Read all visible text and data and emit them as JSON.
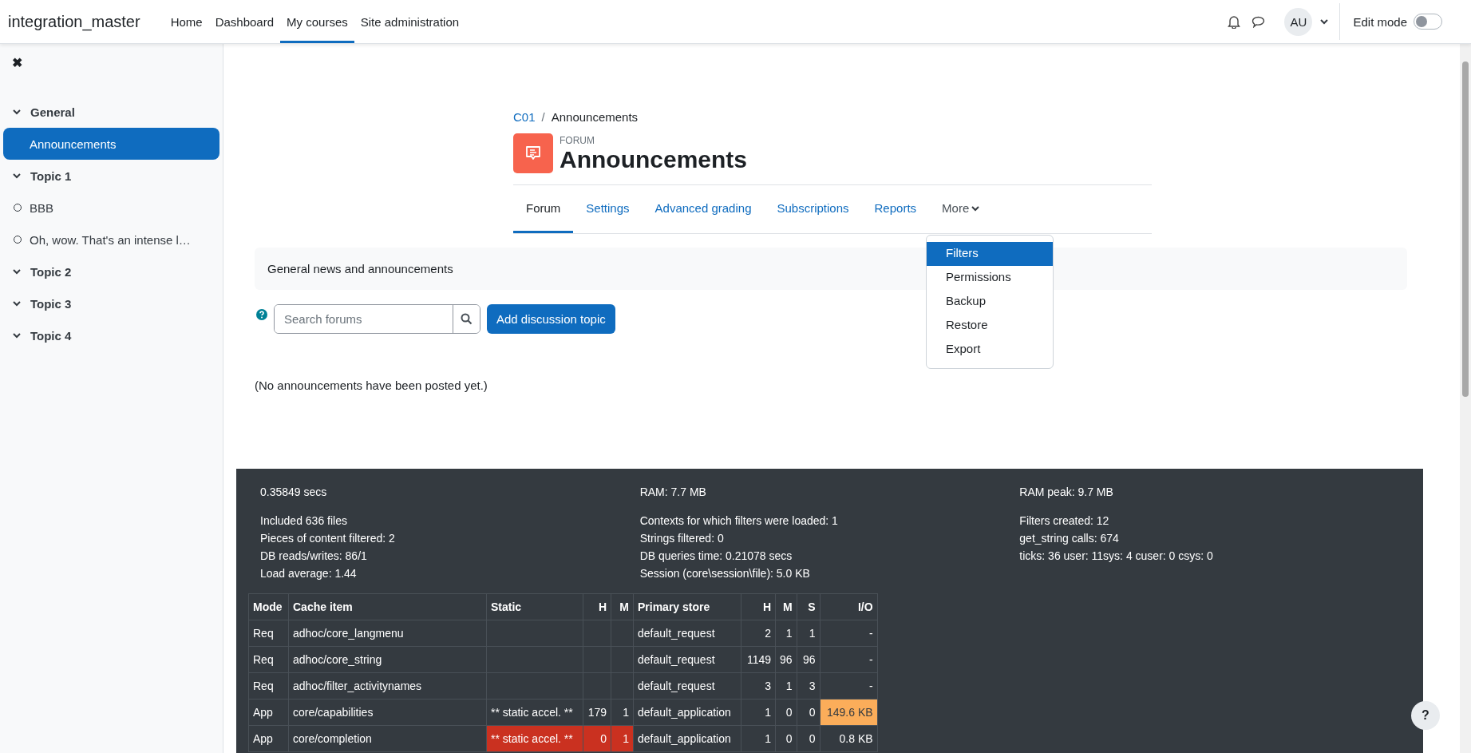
{
  "navbar": {
    "site_name": "integration_master",
    "links": [
      {
        "label": "Home",
        "selected": false
      },
      {
        "label": "Dashboard",
        "selected": false
      },
      {
        "label": "My courses",
        "selected": true
      },
      {
        "label": "Site administration",
        "selected": false
      }
    ],
    "avatar": "AU",
    "edit_mode": {
      "label": "Edit mode",
      "on": false
    }
  },
  "sidebar": {
    "close": "✖",
    "sections": [
      {
        "title": "General",
        "expanded": true,
        "items": [
          {
            "label": "Announcements",
            "kind": "forum",
            "selected": true
          }
        ]
      },
      {
        "title": "Topic 1",
        "expanded": true,
        "items": [
          {
            "label": "BBB",
            "kind": "activity",
            "selected": false
          },
          {
            "label": "Oh, wow. That's an intense l…",
            "kind": "activity",
            "selected": false
          }
        ]
      },
      {
        "title": "Topic 2",
        "expanded": true
      },
      {
        "title": "Topic 3",
        "expanded": true
      },
      {
        "title": "Topic 4",
        "expanded": true
      }
    ]
  },
  "breadcrumb": {
    "items": [
      "C01",
      "Announcements"
    ],
    "separator": "/"
  },
  "page_header": {
    "kind_label": "FORUM",
    "title": "Announcements"
  },
  "tabs": [
    {
      "label": "Forum",
      "selected": true
    },
    {
      "label": "Settings",
      "selected": false
    },
    {
      "label": "Advanced grading",
      "selected": false
    },
    {
      "label": "Subscriptions",
      "selected": false
    },
    {
      "label": "Reports",
      "selected": false
    },
    {
      "label": "More",
      "selected": false
    }
  ],
  "more_menu": [
    {
      "label": "Filters",
      "selected": true
    },
    {
      "label": "Permissions",
      "selected": false
    },
    {
      "label": "Backup",
      "selected": false
    },
    {
      "label": "Restore",
      "selected": false
    },
    {
      "label": "Export",
      "selected": false
    }
  ],
  "intro": "General news and announcements",
  "search": {
    "placeholder": "Search forums"
  },
  "add_button": "Add discussion topic",
  "empty_message": "(No announcements have been posted yet.)",
  "perf": {
    "columns": [
      [
        "0.35849 secs"
      ],
      [
        "RAM: 7.7 MB"
      ],
      [
        "RAM peak: 9.7 MB"
      ]
    ],
    "details": [
      [
        "Included 636 files",
        "Pieces of content filtered: 2",
        "DB reads/writes: 86/1",
        "Load average: 1.44"
      ],
      [
        "Contexts for which filters were loaded: 1",
        "Strings filtered: 0",
        "DB queries time: 0.21078 secs",
        "Session (core\\session\\file): 5.0 KB"
      ],
      [
        "Filters created: 12",
        "get_string calls: 674",
        "ticks: 36 user: 11sys: 4 cuser: 0 csys: 0"
      ]
    ]
  },
  "cache_table": {
    "columns": [
      "Mode",
      "Cache item",
      "Static",
      "H",
      "M",
      "Primary store",
      "H",
      "M",
      "S",
      "I/O"
    ],
    "rows": [
      [
        {
          "text": "Req"
        },
        {
          "text": "adhoc/core_langmenu"
        },
        {},
        {},
        {},
        {
          "text": "default_request"
        },
        {
          "text": "2"
        },
        {
          "text": "1"
        },
        {
          "text": "1"
        },
        {
          "text": "-"
        }
      ],
      [
        {
          "text": "Req"
        },
        {
          "text": "adhoc/core_string"
        },
        {},
        {},
        {},
        {
          "text": "default_request"
        },
        {
          "text": "1149"
        },
        {
          "text": "96"
        },
        {
          "text": "96"
        },
        {
          "text": "-"
        }
      ],
      [
        {
          "text": "Req"
        },
        {
          "text": "adhoc/filter_activitynames"
        },
        {},
        {},
        {},
        {
          "text": "default_request"
        },
        {
          "text": "3"
        },
        {
          "text": "1"
        },
        {
          "text": "3"
        },
        {
          "text": "-"
        }
      ],
      [
        {
          "text": "App"
        },
        {
          "text": "core/capabilities"
        },
        {
          "text": "** static accel. **"
        },
        {
          "text": "179"
        },
        {
          "text": "1"
        },
        {
          "text": "default_application"
        },
        {
          "text": "1"
        },
        {
          "text": "0"
        },
        {
          "text": "0"
        },
        {
          "text": "149.6 KB",
          "color": "#fbad5a"
        }
      ],
      [
        {
          "text": "App"
        },
        {
          "text": "core/completion"
        },
        {
          "text": "** static accel. **",
          "color": "#ca3120"
        },
        {
          "text": "0",
          "color": "#ca3120"
        },
        {
          "text": "1",
          "color": "#ca3120"
        },
        {
          "text": "default_application"
        },
        {
          "text": "1"
        },
        {
          "text": "0"
        },
        {
          "text": "0"
        },
        {
          "text": "0.8 KB"
        }
      ]
    ]
  },
  "help_button": "?"
}
